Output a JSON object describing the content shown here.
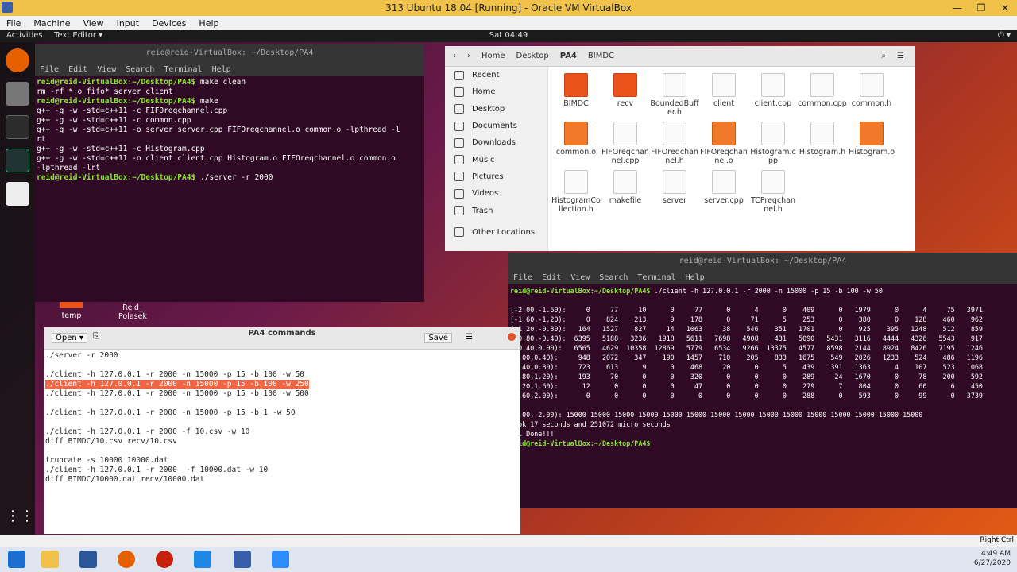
{
  "vbox": {
    "title": "313 Ubuntu 18.04 [Running] - Oracle VM VirtualBox",
    "menu": [
      "File",
      "Machine",
      "View",
      "Input",
      "Devices",
      "Help"
    ]
  },
  "gnome": {
    "activities": "Activities",
    "app_menu": "Text Editor ▾",
    "clock": "Sat 04:49"
  },
  "term1": {
    "title": "reid@reid-VirtualBox: ~/Desktop/PA4",
    "menu": [
      "File",
      "Edit",
      "View",
      "Search",
      "Terminal",
      "Help"
    ],
    "lines": [
      {
        "p": "reid@reid-VirtualBox:~/Desktop/PA4$",
        "t": " make clean"
      },
      {
        "p": "",
        "t": "rm -rf *.o fifo* server client"
      },
      {
        "p": "reid@reid-VirtualBox:~/Desktop/PA4$",
        "t": " make"
      },
      {
        "p": "",
        "t": "g++ -g -w -std=c++11 -c FIFOreqchannel.cpp"
      },
      {
        "p": "",
        "t": "g++ -g -w -std=c++11 -c common.cpp"
      },
      {
        "p": "",
        "t": "g++ -g -w -std=c++11 -o server server.cpp FIFOreqchannel.o common.o -lpthread -l"
      },
      {
        "p": "",
        "t": "rt"
      },
      {
        "p": "",
        "t": "g++ -g -w -std=c++11 -c Histogram.cpp"
      },
      {
        "p": "",
        "t": "g++ -g -w -std=c++11 -o client client.cpp Histogram.o FIFOreqchannel.o common.o"
      },
      {
        "p": "",
        "t": "-lpthread -lrt"
      },
      {
        "p": "reid@reid-VirtualBox:~/Desktop/PA4$",
        "t": " ./server -r 2000"
      }
    ]
  },
  "files": {
    "path": [
      "Home",
      "Desktop",
      "PA4",
      "BIMDC"
    ],
    "sidebar": [
      "Recent",
      "Home",
      "Desktop",
      "Documents",
      "Downloads",
      "Music",
      "Pictures",
      "Videos",
      "Trash",
      "Other Locations"
    ],
    "items": [
      {
        "name": "BIMDC",
        "kind": "folder"
      },
      {
        "name": "recv",
        "kind": "folder"
      },
      {
        "name": "BoundedBuffer.h",
        "kind": "file"
      },
      {
        "name": "client",
        "kind": "file"
      },
      {
        "name": "client.cpp",
        "kind": "file"
      },
      {
        "name": "common.cpp",
        "kind": "file"
      },
      {
        "name": "common.h",
        "kind": "file"
      },
      {
        "name": "common.o",
        "kind": "o"
      },
      {
        "name": "FIFOreqchannel.cpp",
        "kind": "file"
      },
      {
        "name": "FIFOreqchannel.h",
        "kind": "file"
      },
      {
        "name": "FIFOreqchannel.o",
        "kind": "o"
      },
      {
        "name": "Histogram.cpp",
        "kind": "file"
      },
      {
        "name": "Histogram.h",
        "kind": "file"
      },
      {
        "name": "Histogram.o",
        "kind": "o"
      },
      {
        "name": "HistogramCollection.h",
        "kind": "file"
      },
      {
        "name": "makefile",
        "kind": "file"
      },
      {
        "name": "server",
        "kind": "file"
      },
      {
        "name": "server.cpp",
        "kind": "file"
      },
      {
        "name": "TCPreqchannel.h",
        "kind": "file"
      }
    ]
  },
  "desktop_icons": [
    {
      "label": "temp"
    },
    {
      "label": "Reid_ Polasek"
    }
  ],
  "gedit": {
    "title": "PA4 commands",
    "open": "Open ▾",
    "save": "Save",
    "lines": [
      "./server -r 2000",
      "",
      "./client -h 127.0.0.1 -r 2000 -n 15000 -p 15 -b 100 -w 50",
      "./client -h 127.0.0.1 -r 2000 -n 15000 -p 15 -b 100 -w 250",
      "./client -h 127.0.0.1 -r 2000 -n 15000 -p 15 -b 100 -w 500",
      "",
      "./client -h 127.0.0.1 -r 2000 -n 15000 -p 15 -b 1 -w 50",
      "",
      "./client -h 127.0.0.1 -r 2000 -f 10.csv -w 10",
      "diff BIMDC/10.csv recv/10.csv",
      "",
      "truncate -s 10000 10000.dat",
      "./client -h 127.0.0.1 -r 2000  -f 10000.dat -w 10",
      "diff BIMDC/10000.dat recv/10000.dat"
    ],
    "highlight_line": 3
  },
  "term2": {
    "title": "reid@reid-VirtualBox: ~/Desktop/PA4",
    "menu": [
      "File",
      "Edit",
      "View",
      "Search",
      "Terminal",
      "Help"
    ],
    "lines": [
      {
        "p": "reid@reid-VirtualBox:~/Desktop/PA4$",
        "t": " ./client -h 127.0.0.1 -r 2000 -n 15000 -p 15 -b 100 -w 50"
      },
      {
        "p": "",
        "t": ""
      },
      {
        "p": "",
        "t": "[-2.00,-1.60):     0     77     10      0     77      0      4      0    409      0   1979      0      4     75   3971"
      },
      {
        "p": "",
        "t": "[-1.60,-1.20):     0    824    213      9    178      0     71      5    253      0    380      0    128    460    962"
      },
      {
        "p": "",
        "t": "[-1.20,-0.80):   164   1527    827     14   1063     38    546    351   1701      0    925    395   1248    512    859"
      },
      {
        "p": "",
        "t": "[-0.80,-0.40):  6395   5188   3236   1918   5611   7698   4908    431   5090   5431   3116   4444   4326   5543    917"
      },
      {
        "p": "",
        "t": "[-0.40,0.00):   6565   4629  10358  12869   5779   6534   9266  13375   4577   8598   2144   8924   8426   7195   1246"
      },
      {
        "p": "",
        "t": "[0.00,0.40):     948   2072    347    190   1457    710    205    833   1675    549   2026   1233    524    486   1196"
      },
      {
        "p": "",
        "t": "[0.40,0.80):     723    613      9      0    468     20      0      5    439    391   1363      4    107    523   1068"
      },
      {
        "p": "",
        "t": "[0.80,1.20):     193     70      0      0    320      0      0      0    289     24   1670      0     78    200    592"
      },
      {
        "p": "",
        "t": "[1.20,1.60):      12      0      0      0     47      0      0      0    279      7    804      0     60      6    450"
      },
      {
        "p": "",
        "t": "[1.60,2.00):       0      0      0      0      0      0      0      0    288      0    593      0     99      0   3739"
      },
      {
        "p": "",
        "t": ""
      },
      {
        "p": "",
        "t": "[1.00, 2.00): 15000 15000 15000 15000 15000 15000 15000 15000 15000 15000 15000 15000 15000 15000 15000"
      },
      {
        "p": "",
        "t": "Took 17 seconds and 251072 micro seconds"
      },
      {
        "p": "",
        "t": "All Done!!!"
      },
      {
        "p": "reid@reid-VirtualBox:~/Desktop/PA4$",
        "t": " "
      }
    ]
  },
  "taskbar": {
    "time": "4:49 AM",
    "date": "6/27/2020",
    "host_key": "Right Ctrl"
  },
  "colors": {
    "vbox_title": "#f0c24a",
    "terminal_bg": "#300a24",
    "prompt": "#8ae234",
    "highlight": "#f06543"
  }
}
